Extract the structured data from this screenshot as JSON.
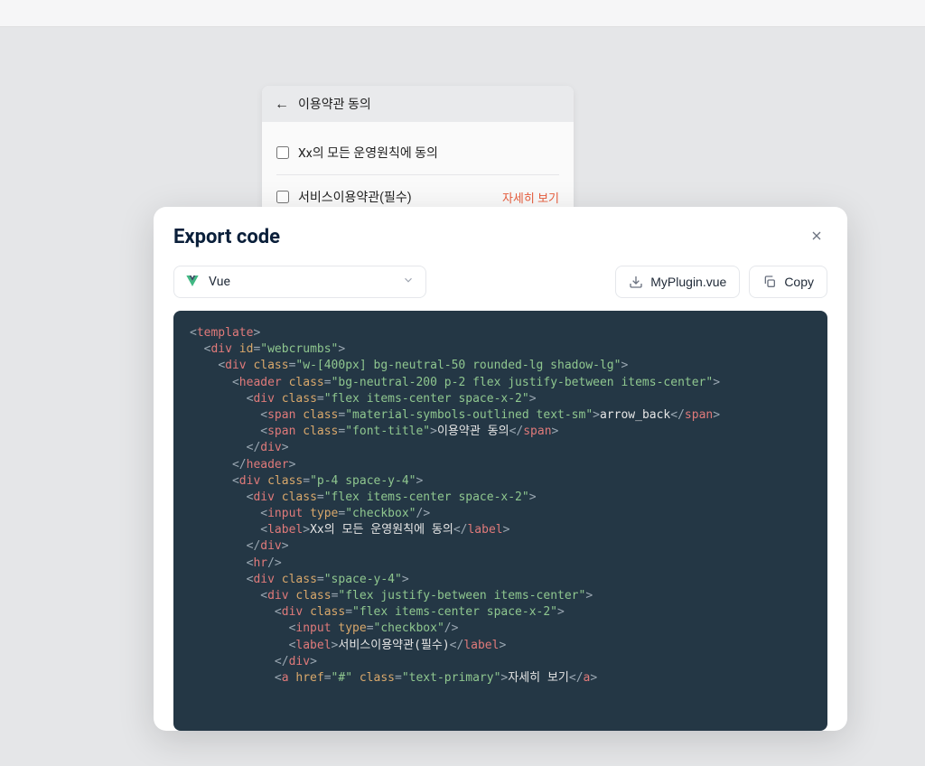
{
  "preview": {
    "header_title": "이용약관 동의",
    "row1_label": "Xx의 모든 운영원칙에 동의",
    "row2_label": "서비스이용약관(필수)",
    "row2_link": "자세히 보기"
  },
  "modal": {
    "title": "Export code",
    "framework": "Vue",
    "filename": "MyPlugin.vue",
    "copy_label": "Copy"
  },
  "code": [
    [
      [
        "p",
        "<"
      ],
      [
        "t",
        "template"
      ],
      [
        "p",
        ">"
      ]
    ],
    [
      [
        "sp",
        "  "
      ],
      [
        "p",
        "<"
      ],
      [
        "t",
        "div"
      ],
      [
        "sp",
        " "
      ],
      [
        "a",
        "id"
      ],
      [
        "p",
        "="
      ],
      [
        "s",
        "\"webcrumbs\""
      ],
      [
        "p",
        ">"
      ]
    ],
    [
      [
        "sp",
        "    "
      ],
      [
        "p",
        "<"
      ],
      [
        "t",
        "div"
      ],
      [
        "sp",
        " "
      ],
      [
        "a",
        "class"
      ],
      [
        "p",
        "="
      ],
      [
        "s",
        "\"w-[400px] bg-neutral-50 rounded-lg shadow-lg\""
      ],
      [
        "p",
        ">"
      ]
    ],
    [
      [
        "sp",
        "      "
      ],
      [
        "p",
        "<"
      ],
      [
        "t",
        "header"
      ],
      [
        "sp",
        " "
      ],
      [
        "a",
        "class"
      ],
      [
        "p",
        "="
      ],
      [
        "s",
        "\"bg-neutral-200 p-2 flex justify-between items-center\""
      ],
      [
        "p",
        ">"
      ]
    ],
    [
      [
        "sp",
        "        "
      ],
      [
        "p",
        "<"
      ],
      [
        "t",
        "div"
      ],
      [
        "sp",
        " "
      ],
      [
        "a",
        "class"
      ],
      [
        "p",
        "="
      ],
      [
        "s",
        "\"flex items-center space-x-2\""
      ],
      [
        "p",
        ">"
      ]
    ],
    [
      [
        "sp",
        "          "
      ],
      [
        "p",
        "<"
      ],
      [
        "t",
        "span"
      ],
      [
        "sp",
        " "
      ],
      [
        "a",
        "class"
      ],
      [
        "p",
        "="
      ],
      [
        "s",
        "\"material-symbols-outlined text-sm\""
      ],
      [
        "p",
        ">"
      ],
      [
        "tx",
        "arrow_back"
      ],
      [
        "p",
        "</"
      ],
      [
        "t",
        "span"
      ],
      [
        "p",
        ">"
      ]
    ],
    [
      [
        "sp",
        "          "
      ],
      [
        "p",
        "<"
      ],
      [
        "t",
        "span"
      ],
      [
        "sp",
        " "
      ],
      [
        "a",
        "class"
      ],
      [
        "p",
        "="
      ],
      [
        "s",
        "\"font-title\""
      ],
      [
        "p",
        ">"
      ],
      [
        "tx",
        "이용약관 동의"
      ],
      [
        "p",
        "</"
      ],
      [
        "t",
        "span"
      ],
      [
        "p",
        ">"
      ]
    ],
    [
      [
        "sp",
        "        "
      ],
      [
        "p",
        "</"
      ],
      [
        "t",
        "div"
      ],
      [
        "p",
        ">"
      ]
    ],
    [
      [
        "sp",
        "      "
      ],
      [
        "p",
        "</"
      ],
      [
        "t",
        "header"
      ],
      [
        "p",
        ">"
      ]
    ],
    [
      [
        "sp",
        ""
      ]
    ],
    [
      [
        "sp",
        "      "
      ],
      [
        "p",
        "<"
      ],
      [
        "t",
        "div"
      ],
      [
        "sp",
        " "
      ],
      [
        "a",
        "class"
      ],
      [
        "p",
        "="
      ],
      [
        "s",
        "\"p-4 space-y-4\""
      ],
      [
        "p",
        ">"
      ]
    ],
    [
      [
        "sp",
        "        "
      ],
      [
        "p",
        "<"
      ],
      [
        "t",
        "div"
      ],
      [
        "sp",
        " "
      ],
      [
        "a",
        "class"
      ],
      [
        "p",
        "="
      ],
      [
        "s",
        "\"flex items-center space-x-2\""
      ],
      [
        "p",
        ">"
      ]
    ],
    [
      [
        "sp",
        "          "
      ],
      [
        "p",
        "<"
      ],
      [
        "t",
        "input"
      ],
      [
        "sp",
        " "
      ],
      [
        "a",
        "type"
      ],
      [
        "p",
        "="
      ],
      [
        "s",
        "\"checkbox\""
      ],
      [
        "p",
        "/>"
      ]
    ],
    [
      [
        "sp",
        "          "
      ],
      [
        "p",
        "<"
      ],
      [
        "t",
        "label"
      ],
      [
        "p",
        ">"
      ],
      [
        "tx",
        "Xx의 모든 운영원칙에 동의"
      ],
      [
        "p",
        "</"
      ],
      [
        "t",
        "label"
      ],
      [
        "p",
        ">"
      ]
    ],
    [
      [
        "sp",
        "        "
      ],
      [
        "p",
        "</"
      ],
      [
        "t",
        "div"
      ],
      [
        "p",
        ">"
      ]
    ],
    [
      [
        "sp",
        ""
      ]
    ],
    [
      [
        "sp",
        "        "
      ],
      [
        "p",
        "<"
      ],
      [
        "t",
        "hr"
      ],
      [
        "p",
        "/>"
      ]
    ],
    [
      [
        "sp",
        ""
      ]
    ],
    [
      [
        "sp",
        "        "
      ],
      [
        "p",
        "<"
      ],
      [
        "t",
        "div"
      ],
      [
        "sp",
        " "
      ],
      [
        "a",
        "class"
      ],
      [
        "p",
        "="
      ],
      [
        "s",
        "\"space-y-4\""
      ],
      [
        "p",
        ">"
      ]
    ],
    [
      [
        "sp",
        "          "
      ],
      [
        "p",
        "<"
      ],
      [
        "t",
        "div"
      ],
      [
        "sp",
        " "
      ],
      [
        "a",
        "class"
      ],
      [
        "p",
        "="
      ],
      [
        "s",
        "\"flex justify-between items-center\""
      ],
      [
        "p",
        ">"
      ]
    ],
    [
      [
        "sp",
        "            "
      ],
      [
        "p",
        "<"
      ],
      [
        "t",
        "div"
      ],
      [
        "sp",
        " "
      ],
      [
        "a",
        "class"
      ],
      [
        "p",
        "="
      ],
      [
        "s",
        "\"flex items-center space-x-2\""
      ],
      [
        "p",
        ">"
      ]
    ],
    [
      [
        "sp",
        "              "
      ],
      [
        "p",
        "<"
      ],
      [
        "t",
        "input"
      ],
      [
        "sp",
        " "
      ],
      [
        "a",
        "type"
      ],
      [
        "p",
        "="
      ],
      [
        "s",
        "\"checkbox\""
      ],
      [
        "p",
        "/>"
      ]
    ],
    [
      [
        "sp",
        "              "
      ],
      [
        "p",
        "<"
      ],
      [
        "t",
        "label"
      ],
      [
        "p",
        ">"
      ],
      [
        "tx",
        "서비스이용약관(필수)"
      ],
      [
        "p",
        "</"
      ],
      [
        "t",
        "label"
      ],
      [
        "p",
        ">"
      ]
    ],
    [
      [
        "sp",
        "            "
      ],
      [
        "p",
        "</"
      ],
      [
        "t",
        "div"
      ],
      [
        "p",
        ">"
      ]
    ],
    [
      [
        "sp",
        "            "
      ],
      [
        "p",
        "<"
      ],
      [
        "t",
        "a"
      ],
      [
        "sp",
        " "
      ],
      [
        "a",
        "href"
      ],
      [
        "p",
        "="
      ],
      [
        "s",
        "\"#\""
      ],
      [
        "sp",
        " "
      ],
      [
        "a",
        "class"
      ],
      [
        "p",
        "="
      ],
      [
        "s",
        "\"text-primary\""
      ],
      [
        "p",
        ">"
      ],
      [
        "tx",
        "자세히 보기"
      ],
      [
        "p",
        "</"
      ],
      [
        "t",
        "a"
      ],
      [
        "p",
        ">"
      ]
    ]
  ]
}
